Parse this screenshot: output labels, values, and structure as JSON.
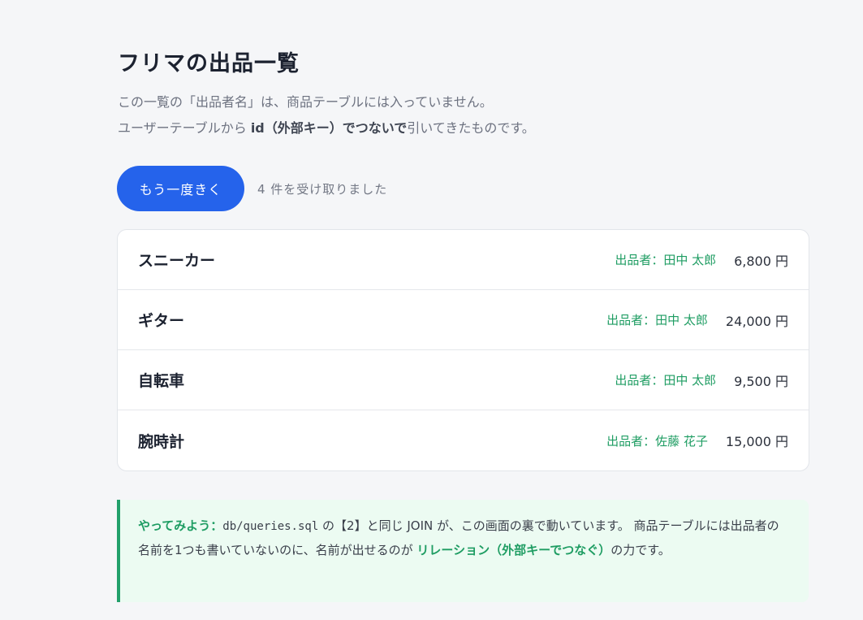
{
  "header": {
    "title": "フリマの出品一覧",
    "desc_line1": "この一覧の「出品者名」は、商品テーブルには入っていません。",
    "desc_line2_a": "ユーザーテーブルから ",
    "desc_line2_b": "id（外部キー）でつないで",
    "desc_line2_c": "引いてきたものです。"
  },
  "actions": {
    "ask_button": "もう一度きく",
    "count_text": "4 件を受け取りました"
  },
  "items": [
    {
      "name": "スニーカー",
      "seller": "出品者：田中 太郎",
      "price": "6,800 円"
    },
    {
      "name": "ギター",
      "seller": "出品者：田中 太郎",
      "price": "24,000 円"
    },
    {
      "name": "自転車",
      "seller": "出品者：田中 太郎",
      "price": "9,500 円"
    },
    {
      "name": "腕時計",
      "seller": "出品者：佐藤 花子",
      "price": "15,000 円"
    }
  ],
  "tip": {
    "label": "やってみよう：",
    "file": "db/queries.sql",
    "text1": " の【2】と同じ JOIN が、この画面の裏で動いています。 商品テーブルには出品者の名前を1つも書いていないのに、名前が出せるのが ",
    "highlight": "リレーション（外部キーでつなぐ）",
    "text2": "の力です。"
  },
  "colors": {
    "accent": "#2563eb",
    "seller_green": "#1f9d63",
    "tip_background": "#ecfbf2",
    "tip_border": "#22a06b",
    "page_background": "#f5f6f8"
  }
}
